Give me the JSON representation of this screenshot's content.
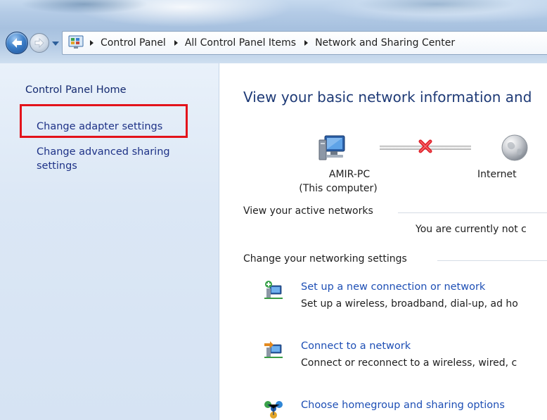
{
  "nav": {
    "breadcrumbs": [
      "Control Panel",
      "All Control Panel Items",
      "Network and Sharing Center"
    ]
  },
  "sidebar": {
    "items": [
      {
        "label": "Control Panel Home"
      },
      {
        "label": "Change adapter settings"
      },
      {
        "label": "Change advanced sharing settings"
      }
    ],
    "highlight_color": "#e3131b"
  },
  "main": {
    "title": "View your basic network information and",
    "map": {
      "computer_name": "AMIR-PC",
      "computer_sub": "(This computer)",
      "internet_label": "Internet",
      "connection_status_icon": "red-x-icon"
    },
    "active_networks": {
      "heading": "View your active networks",
      "status": "You are currently not c"
    },
    "settings": {
      "heading": "Change your networking settings",
      "tasks": [
        {
          "icon": "new-connection-icon",
          "title": "Set up a new connection or network",
          "desc": "Set up a wireless, broadband, dial-up, ad ho"
        },
        {
          "icon": "connect-network-icon",
          "title": "Connect to a network",
          "desc": "Connect or reconnect to a wireless, wired, c"
        },
        {
          "icon": "homegroup-icon",
          "title": "Choose homegroup and sharing options",
          "desc": ""
        }
      ]
    }
  },
  "colors": {
    "link": "#1e4fb5",
    "title": "#1e3a76",
    "left_pane": "#dbe7f5"
  }
}
